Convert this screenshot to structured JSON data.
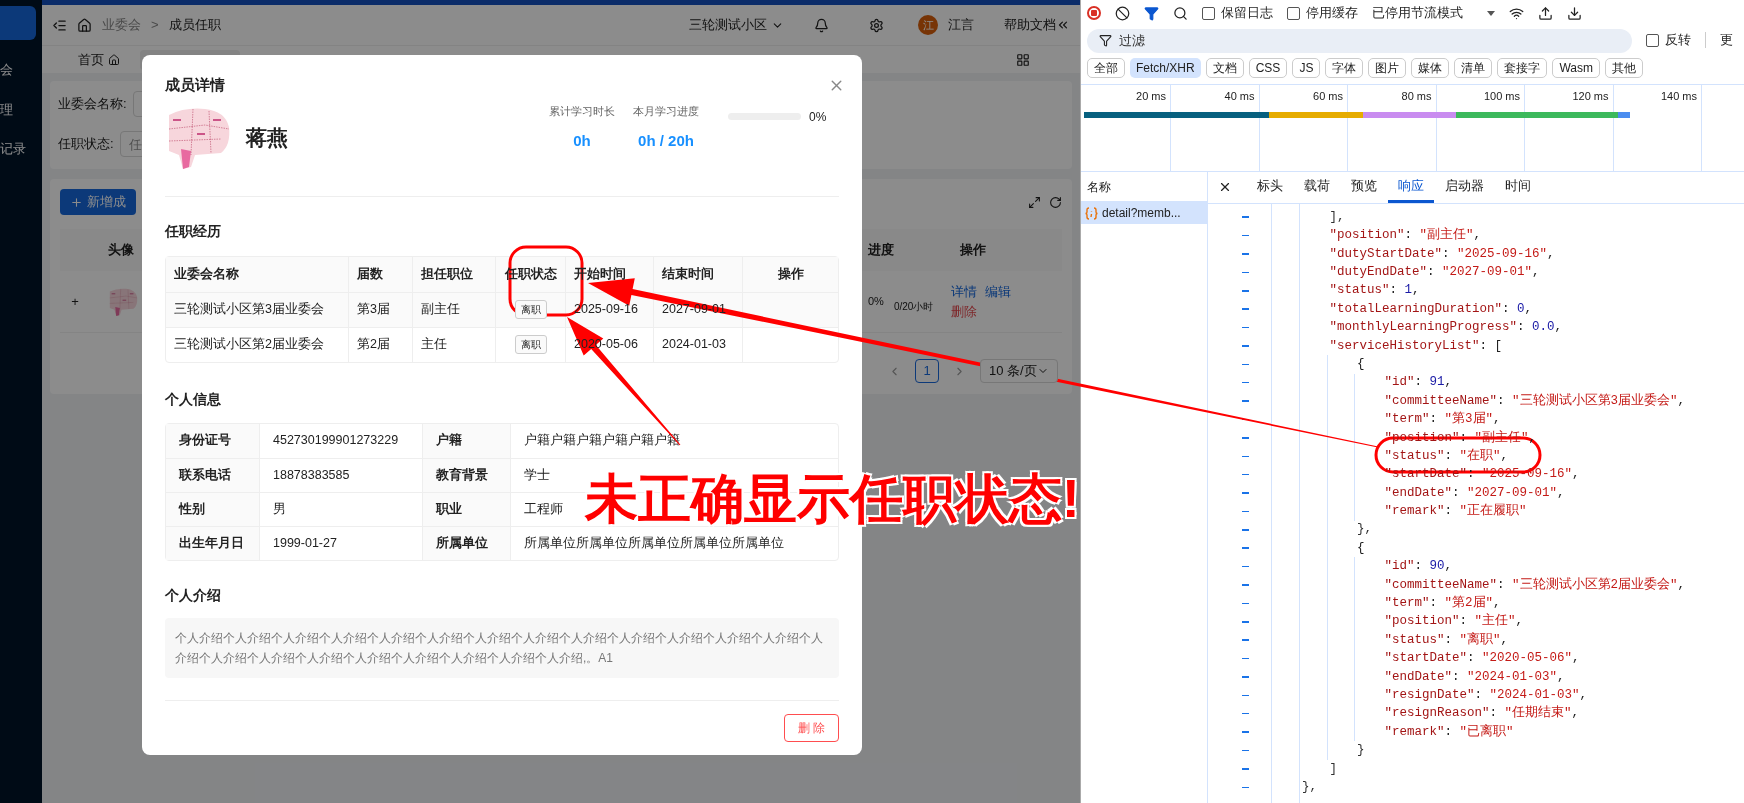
{
  "sidebar": {
    "items": [
      {
        "label": "会"
      },
      {
        "label": "理"
      },
      {
        "label": "记录"
      }
    ]
  },
  "header": {
    "breadcrumb": [
      "业委会",
      "成员任职"
    ],
    "separator": ">",
    "community": "三轮测试小区",
    "avatar": "江",
    "user": "江言",
    "help": "帮助文档"
  },
  "tabs": [
    {
      "label": "首页",
      "selected": false
    }
  ],
  "filters": [
    {
      "label": "业委会名称:"
    },
    {
      "label": "任职状态:",
      "placeholder": "任"
    }
  ],
  "table": {
    "add_button": "新增成",
    "columns": [
      "头像",
      "进度",
      "操作"
    ],
    "rows": [
      {
        "expand": "+",
        "progress": "0%",
        "hours": "0/20小时",
        "actions": [
          {
            "label": "详情",
            "kind": "link"
          },
          {
            "label": "编辑",
            "kind": "link"
          },
          {
            "label": "删除",
            "kind": "danger"
          }
        ]
      }
    ],
    "pagination": {
      "pages": [
        {
          "label": "1",
          "selected": true
        }
      ],
      "page_size": "10 条/页"
    }
  },
  "modal": {
    "title": "成员详情",
    "name": "蒋燕",
    "stats": [
      {
        "label": "累计学习时长",
        "value": "0h"
      },
      {
        "label": "本月学习进度",
        "value": "0h / 20h"
      }
    ],
    "progress": {
      "level": 0,
      "reading": "0%"
    },
    "history": {
      "title": "任职经历",
      "columns": [
        "业委会名称",
        "届数",
        "担任职位",
        "任职状态",
        "开始时间",
        "结束时间",
        "操作"
      ],
      "rows": [
        {
          "committee": "三轮测试小区第3届业委会",
          "term": "第3届",
          "position": "副主任",
          "status": "离职",
          "start": "2025-09-16",
          "end": "2027-09-01"
        },
        {
          "committee": "三轮测试小区第2届业委会",
          "term": "第2届",
          "position": "主任",
          "status": "离职",
          "start": "2020-05-06",
          "end": "2024-01-03"
        }
      ]
    },
    "info": {
      "title": "个人信息",
      "rows": [
        [
          "身份证号",
          "452730199901273229",
          "户籍",
          "户籍户籍户籍户籍户籍户籍"
        ],
        [
          "联系电话",
          "18878383585",
          "教育背景",
          "学士"
        ],
        [
          "性别",
          "男",
          "职业",
          "工程师"
        ],
        [
          "出生年月日",
          "1999-01-27",
          "所属单位",
          "所属单位所属单位所属单位所属单位所属单位"
        ]
      ]
    },
    "intro": {
      "title": "个人介绍",
      "text": "个人介绍个人介绍个人介绍个人介绍个人介绍个人介绍个人介绍个人介绍个人介绍个人介绍个人介绍个人介绍个人介绍个人介绍个人介绍个人介绍个人介绍个人介绍个人介绍个人介绍个人介绍个人介绍,。A1"
    },
    "delete_button": "删 除"
  },
  "devtools": {
    "preserve_log": {
      "label": "保留日志",
      "checked": false
    },
    "disable_cache": {
      "label": "停用缓存",
      "checked": false
    },
    "throttle": "已停用节流模式",
    "filter_placeholder": "过滤",
    "invert": {
      "label": "反转",
      "checked": false
    },
    "more": "更",
    "chips": [
      {
        "label": "全部",
        "selected": false
      },
      {
        "label": "Fetch/XHR",
        "selected": true
      },
      {
        "label": "文档",
        "selected": false
      },
      {
        "label": "CSS",
        "selected": false
      },
      {
        "label": "JS",
        "selected": false
      },
      {
        "label": "字体",
        "selected": false
      },
      {
        "label": "图片",
        "selected": false
      },
      {
        "label": "媒体",
        "selected": false
      },
      {
        "label": "清单",
        "selected": false
      },
      {
        "label": "套接字",
        "selected": false
      },
      {
        "label": "Wasm",
        "selected": false
      },
      {
        "label": "其他",
        "selected": false
      }
    ],
    "timeline_ticks": [
      "20 ms",
      "40 ms",
      "60 ms",
      "80 ms",
      "100 ms",
      "120 ms",
      "140 ms"
    ],
    "name_header": "名称",
    "requests": [
      {
        "label": "detail?memb...",
        "selected": true
      }
    ],
    "detail_tabs": [
      {
        "label": "标头",
        "selected": false
      },
      {
        "label": "载荷",
        "selected": false
      },
      {
        "label": "预览",
        "selected": false
      },
      {
        "label": "响应",
        "selected": true
      },
      {
        "label": "启动器",
        "selected": false
      },
      {
        "label": "时间",
        "selected": false
      }
    ],
    "response": [
      {
        "close": "},",
        "children": [
          {
            "text": "],",
            "kind": "punct"
          },
          {
            "text": "\"position\": \"副主任\",",
            "kind": "string"
          },
          {
            "text": "\"dutyStartDate\": \"2025-09-16\",",
            "kind": "string"
          },
          {
            "text": "\"dutyEndDate\": \"2027-09-01\",",
            "kind": "string"
          },
          {
            "text": "\"status\": 1,",
            "kind": "number"
          },
          {
            "text": "\"totalLearningDuration\": 0,",
            "kind": "number"
          },
          {
            "text": "\"monthlyLearningProgress\": 0.0,",
            "kind": "number"
          },
          {
            "text": "\"serviceHistoryList\": [",
            "kind": "open",
            "close": "]",
            "children": [
              {
                "text": "{",
                "kind": "open",
                "close": "},",
                "children": [
                  {
                    "text": "\"id\": 91,",
                    "kind": "number"
                  },
                  {
                    "text": "\"committeeName\": \"三轮测试小区第3届业委会\",",
                    "kind": "string"
                  },
                  {
                    "text": "\"term\": \"第3届\",",
                    "kind": "string"
                  },
                  {
                    "text": "\"position\": \"副主任\",",
                    "kind": "string"
                  },
                  {
                    "text": "\"status\": \"在职\",",
                    "kind": "string"
                  },
                  {
                    "text": "\"startDate\": \"2025-09-16\",",
                    "kind": "string"
                  },
                  {
                    "text": "\"endDate\": \"2027-09-01\",",
                    "kind": "string"
                  },
                  {
                    "text": "\"remark\": \"正在履职\"",
                    "kind": "string"
                  }
                ]
              },
              {
                "text": "{",
                "kind": "open",
                "close": "}",
                "children": [
                  {
                    "text": "\"id\": 90,",
                    "kind": "number"
                  },
                  {
                    "text": "\"committeeName\": \"三轮测试小区第2届业委会\",",
                    "kind": "string"
                  },
                  {
                    "text": "\"term\": \"第2届\",",
                    "kind": "string"
                  },
                  {
                    "text": "\"position\": \"主任\",",
                    "kind": "string"
                  },
                  {
                    "text": "\"status\": \"离职\",",
                    "kind": "string"
                  },
                  {
                    "text": "\"startDate\": \"2020-05-06\",",
                    "kind": "string"
                  },
                  {
                    "text": "\"endDate\": \"2024-01-03\",",
                    "kind": "string"
                  },
                  {
                    "text": "\"resignDate\": \"2024-01-03\",",
                    "kind": "string"
                  },
                  {
                    "text": "\"resignReason\": \"任期结束\",",
                    "kind": "string"
                  },
                  {
                    "text": "\"remark\": \"已离职\"",
                    "kind": "string"
                  }
                ]
              }
            ]
          }
        ]
      }
    ]
  },
  "annotation": {
    "text": "未正确显示任职状态!"
  }
}
